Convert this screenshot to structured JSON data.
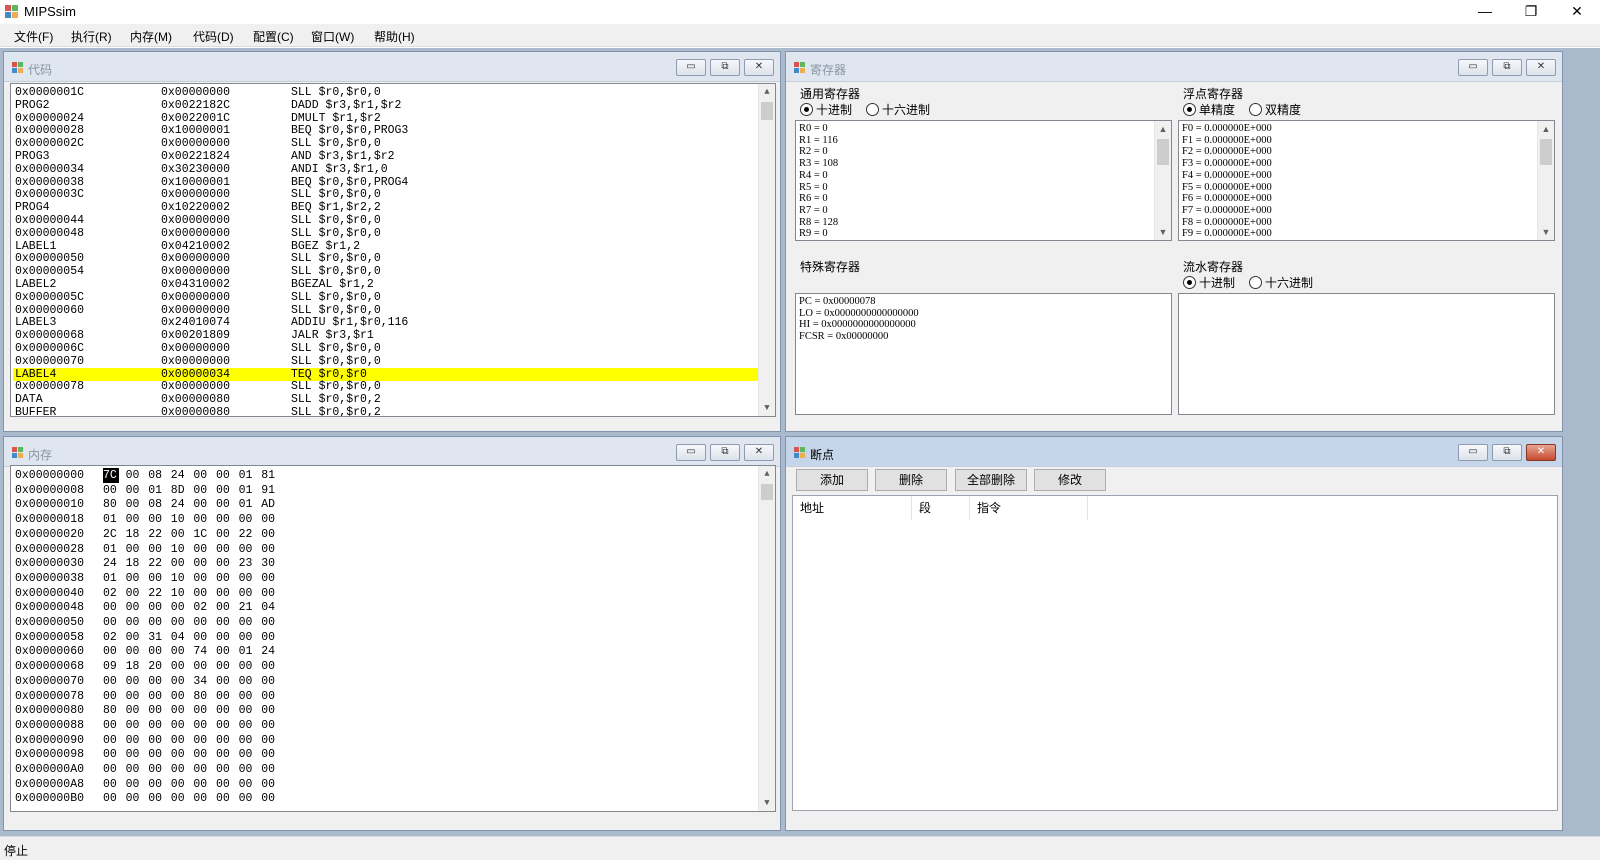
{
  "window": {
    "title": "MIPSsim",
    "minimize": "—",
    "maximize": "❐",
    "close": "✕"
  },
  "menu": [
    "文件(F)",
    "执行(R)",
    "内存(M)",
    "代码(D)",
    "配置(C)",
    "窗口(W)",
    "帮助(H)"
  ],
  "child_buttons": {
    "minimize": "▭",
    "restore": "⧉",
    "close": "✕"
  },
  "code": {
    "title": "代码",
    "highlighted_index": 22,
    "rows": [
      [
        "0x0000001C",
        "0x00000000",
        "SLL $r0,$r0,0"
      ],
      [
        "PROG2",
        "0x0022182C",
        "DADD $r3,$r1,$r2"
      ],
      [
        "0x00000024",
        "0x0022001C",
        "DMULT $r1,$r2"
      ],
      [
        "0x00000028",
        "0x10000001",
        "BEQ $r0,$r0,PROG3"
      ],
      [
        "0x0000002C",
        "0x00000000",
        "SLL $r0,$r0,0"
      ],
      [
        "PROG3",
        "0x00221824",
        "AND $r3,$r1,$r2"
      ],
      [
        "0x00000034",
        "0x30230000",
        "ANDI $r3,$r1,0"
      ],
      [
        "0x00000038",
        "0x10000001",
        "BEQ $r0,$r0,PROG4"
      ],
      [
        "0x0000003C",
        "0x00000000",
        "SLL $r0,$r0,0"
      ],
      [
        "PROG4",
        "0x10220002",
        "BEQ $r1,$r2,2"
      ],
      [
        "0x00000044",
        "0x00000000",
        "SLL $r0,$r0,0"
      ],
      [
        "0x00000048",
        "0x00000000",
        "SLL $r0,$r0,0"
      ],
      [
        "LABEL1",
        "0x04210002",
        "BGEZ $r1,2"
      ],
      [
        "0x00000050",
        "0x00000000",
        "SLL $r0,$r0,0"
      ],
      [
        "0x00000054",
        "0x00000000",
        "SLL $r0,$r0,0"
      ],
      [
        "LABEL2",
        "0x04310002",
        "BGEZAL $r1,2"
      ],
      [
        "0x0000005C",
        "0x00000000",
        "SLL $r0,$r0,0"
      ],
      [
        "0x00000060",
        "0x00000000",
        "SLL $r0,$r0,0"
      ],
      [
        "LABEL3",
        "0x24010074",
        "ADDIU $r1,$r0,116"
      ],
      [
        "0x00000068",
        "0x00201809",
        "JALR $r3,$r1"
      ],
      [
        "0x0000006C",
        "0x00000000",
        "SLL $r0,$r0,0"
      ],
      [
        "0x00000070",
        "0x00000000",
        "SLL $r0,$r0,0"
      ],
      [
        "LABEL4",
        "0x00000034",
        "TEQ $r0,$r0"
      ],
      [
        "0x00000078",
        "0x00000000",
        "SLL $r0,$r0,0"
      ],
      [
        "DATA",
        "0x00000080",
        "SLL $r0,$r0,2"
      ],
      [
        "BUFFER",
        "0x00000080",
        "SLL $r0,$r0,2"
      ]
    ]
  },
  "registers": {
    "title": "寄存器",
    "general": {
      "label": "通用寄存器",
      "opt_dec": "十进制",
      "opt_hex": "十六进制",
      "selected": "dec",
      "rows": [
        "R0 = 0",
        "R1 = 116",
        "R2 = 0",
        "R3 = 108",
        "R4 = 0",
        "R5 = 0",
        "R6 = 0",
        "R7 = 0",
        "R8 = 128",
        "R9 = 0"
      ]
    },
    "float": {
      "label": "浮点寄存器",
      "opt_single": "单精度",
      "opt_double": "双精度",
      "selected": "single",
      "rows": [
        "F0 = 0.000000E+000",
        "F1 = 0.000000E+000",
        "F2 = 0.000000E+000",
        "F3 = 0.000000E+000",
        "F4 = 0.000000E+000",
        "F5 = 0.000000E+000",
        "F6 = 0.000000E+000",
        "F7 = 0.000000E+000",
        "F8 = 0.000000E+000",
        "F9 = 0.000000E+000"
      ]
    },
    "special": {
      "label": "特殊寄存器",
      "rows": [
        "PC = 0x00000078",
        "LO = 0x0000000000000000",
        "HI = 0x0000000000000000",
        "FCSR = 0x00000000"
      ]
    },
    "pipeline": {
      "label": "流水寄存器",
      "opt_dec": "十进制",
      "opt_hex": "十六进制",
      "selected": "dec",
      "rows": []
    }
  },
  "memory": {
    "title": "内存",
    "selected": [
      0,
      0
    ],
    "rows": [
      [
        "0x00000000",
        [
          "7C",
          "00",
          "08",
          "24",
          "00",
          "00",
          "01",
          "81"
        ]
      ],
      [
        "0x00000008",
        [
          "00",
          "00",
          "01",
          "8D",
          "00",
          "00",
          "01",
          "91"
        ]
      ],
      [
        "0x00000010",
        [
          "80",
          "00",
          "08",
          "24",
          "00",
          "00",
          "01",
          "AD"
        ]
      ],
      [
        "0x00000018",
        [
          "01",
          "00",
          "00",
          "10",
          "00",
          "00",
          "00",
          "00"
        ]
      ],
      [
        "0x00000020",
        [
          "2C",
          "18",
          "22",
          "00",
          "1C",
          "00",
          "22",
          "00"
        ]
      ],
      [
        "0x00000028",
        [
          "01",
          "00",
          "00",
          "10",
          "00",
          "00",
          "00",
          "00"
        ]
      ],
      [
        "0x00000030",
        [
          "24",
          "18",
          "22",
          "00",
          "00",
          "00",
          "23",
          "30"
        ]
      ],
      [
        "0x00000038",
        [
          "01",
          "00",
          "00",
          "10",
          "00",
          "00",
          "00",
          "00"
        ]
      ],
      [
        "0x00000040",
        [
          "02",
          "00",
          "22",
          "10",
          "00",
          "00",
          "00",
          "00"
        ]
      ],
      [
        "0x00000048",
        [
          "00",
          "00",
          "00",
          "00",
          "02",
          "00",
          "21",
          "04"
        ]
      ],
      [
        "0x00000050",
        [
          "00",
          "00",
          "00",
          "00",
          "00",
          "00",
          "00",
          "00"
        ]
      ],
      [
        "0x00000058",
        [
          "02",
          "00",
          "31",
          "04",
          "00",
          "00",
          "00",
          "00"
        ]
      ],
      [
        "0x00000060",
        [
          "00",
          "00",
          "00",
          "00",
          "74",
          "00",
          "01",
          "24"
        ]
      ],
      [
        "0x00000068",
        [
          "09",
          "18",
          "20",
          "00",
          "00",
          "00",
          "00",
          "00"
        ]
      ],
      [
        "0x00000070",
        [
          "00",
          "00",
          "00",
          "00",
          "34",
          "00",
          "00",
          "00"
        ]
      ],
      [
        "0x00000078",
        [
          "00",
          "00",
          "00",
          "00",
          "80",
          "00",
          "00",
          "00"
        ]
      ],
      [
        "0x00000080",
        [
          "80",
          "00",
          "00",
          "00",
          "00",
          "00",
          "00",
          "00"
        ]
      ],
      [
        "0x00000088",
        [
          "00",
          "00",
          "00",
          "00",
          "00",
          "00",
          "00",
          "00"
        ]
      ],
      [
        "0x00000090",
        [
          "00",
          "00",
          "00",
          "00",
          "00",
          "00",
          "00",
          "00"
        ]
      ],
      [
        "0x00000098",
        [
          "00",
          "00",
          "00",
          "00",
          "00",
          "00",
          "00",
          "00"
        ]
      ],
      [
        "0x000000A0",
        [
          "00",
          "00",
          "00",
          "00",
          "00",
          "00",
          "00",
          "00"
        ]
      ],
      [
        "0x000000A8",
        [
          "00",
          "00",
          "00",
          "00",
          "00",
          "00",
          "00",
          "00"
        ]
      ],
      [
        "0x000000B0",
        [
          "00",
          "00",
          "00",
          "00",
          "00",
          "00",
          "00",
          "00"
        ]
      ]
    ]
  },
  "breakpoints": {
    "title": "断点",
    "buttons": [
      "添加",
      "删除",
      "全部删除",
      "修改"
    ],
    "columns": [
      "地址",
      "段",
      "指令"
    ],
    "rows": []
  },
  "status": "停止"
}
